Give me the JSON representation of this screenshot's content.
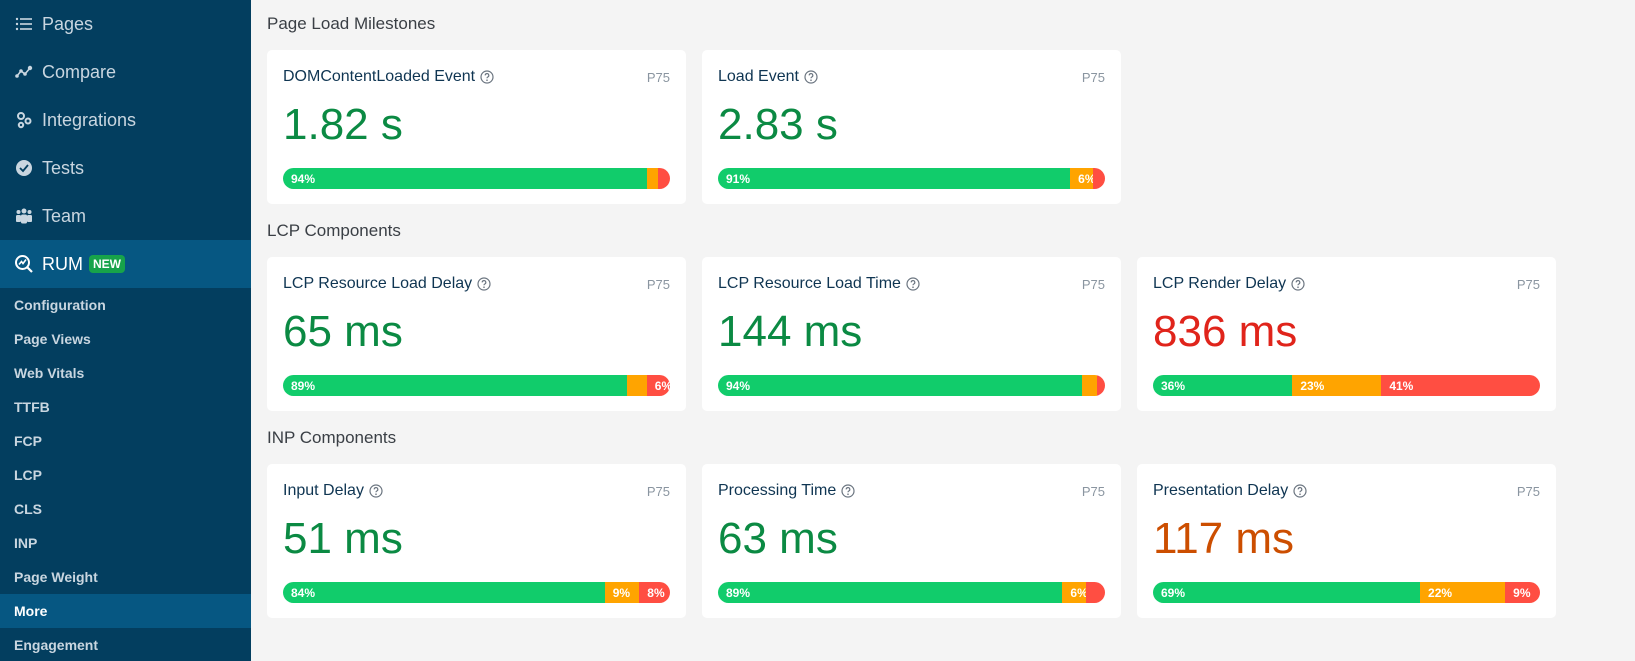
{
  "colors": {
    "sidebar_bg": "#033e5f",
    "sidebar_active": "#065782",
    "good": "#11cc6b",
    "needs_improvement": "#ffa400",
    "poor": "#ff4e42",
    "value_good": "#0b8a43",
    "value_poor": "#e0241b",
    "value_needs_improvement": "#cc4e00"
  },
  "sidebar": {
    "items": [
      {
        "label": "Pages",
        "icon": "list-icon"
      },
      {
        "label": "Compare",
        "icon": "compare-icon"
      },
      {
        "label": "Integrations",
        "icon": "gears-icon"
      },
      {
        "label": "Tests",
        "icon": "check-circle-icon"
      },
      {
        "label": "Team",
        "icon": "team-icon"
      },
      {
        "label": "RUM",
        "icon": "rum-search-icon",
        "badge": "NEW",
        "active": true
      }
    ],
    "subitems": [
      {
        "label": "Configuration"
      },
      {
        "label": "Page Views"
      },
      {
        "label": "Web Vitals"
      },
      {
        "label": "TTFB"
      },
      {
        "label": "FCP"
      },
      {
        "label": "LCP"
      },
      {
        "label": "CLS"
      },
      {
        "label": "INP"
      },
      {
        "label": "Page Weight"
      },
      {
        "label": "More",
        "active": true
      },
      {
        "label": "Engagement"
      }
    ]
  },
  "sections": [
    {
      "title": "Page Load Milestones",
      "cards": [
        {
          "title": "DOMContentLoaded Event",
          "percentile": "P75",
          "value": "1.82 s",
          "rating": "good",
          "distribution": [
            {
              "pct": 94,
              "label": "94%"
            },
            {
              "pct": 3,
              "label": ""
            },
            {
              "pct": 3,
              "label": ""
            }
          ]
        },
        {
          "title": "Load Event",
          "percentile": "P75",
          "value": "2.83 s",
          "rating": "good",
          "distribution": [
            {
              "pct": 91,
              "label": "91%"
            },
            {
              "pct": 6,
              "label": "6%"
            },
            {
              "pct": 3,
              "label": ""
            }
          ]
        }
      ]
    },
    {
      "title": "LCP Components",
      "cards": [
        {
          "title": "LCP Resource Load Delay",
          "percentile": "P75",
          "value": "65 ms",
          "rating": "good",
          "distribution": [
            {
              "pct": 89,
              "label": "89%"
            },
            {
              "pct": 5,
              "label": ""
            },
            {
              "pct": 6,
              "label": "6%"
            }
          ]
        },
        {
          "title": "LCP Resource Load Time",
          "percentile": "P75",
          "value": "144 ms",
          "rating": "good",
          "distribution": [
            {
              "pct": 94,
              "label": "94%"
            },
            {
              "pct": 4,
              "label": ""
            },
            {
              "pct": 2,
              "label": ""
            }
          ]
        },
        {
          "title": "LCP Render Delay",
          "percentile": "P75",
          "value": "836 ms",
          "rating": "poor",
          "distribution": [
            {
              "pct": 36,
              "label": "36%"
            },
            {
              "pct": 23,
              "label": "23%"
            },
            {
              "pct": 41,
              "label": "41%"
            }
          ]
        }
      ]
    },
    {
      "title": "INP Components",
      "cards": [
        {
          "title": "Input Delay",
          "percentile": "P75",
          "value": "51 ms",
          "rating": "good",
          "distribution": [
            {
              "pct": 84,
              "label": "84%"
            },
            {
              "pct": 9,
              "label": "9%"
            },
            {
              "pct": 8,
              "label": "8%"
            }
          ]
        },
        {
          "title": "Processing Time",
          "percentile": "P75",
          "value": "63 ms",
          "rating": "good",
          "distribution": [
            {
              "pct": 89,
              "label": "89%"
            },
            {
              "pct": 6,
              "label": "6%"
            },
            {
              "pct": 5,
              "label": ""
            }
          ]
        },
        {
          "title": "Presentation Delay",
          "percentile": "P75",
          "value": "117 ms",
          "rating": "needs_improvement",
          "distribution": [
            {
              "pct": 69,
              "label": "69%"
            },
            {
              "pct": 22,
              "label": "22%"
            },
            {
              "pct": 9,
              "label": "9%"
            }
          ]
        }
      ]
    }
  ]
}
